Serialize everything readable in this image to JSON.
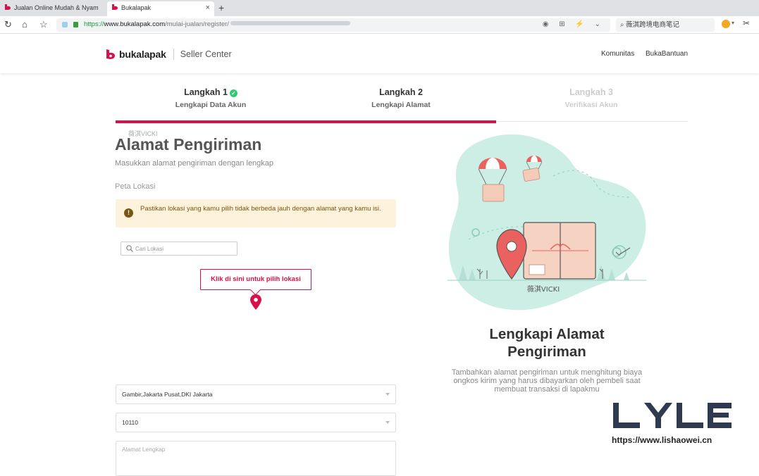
{
  "browser": {
    "tabs": [
      {
        "title": "Jualan Online Mudah & Nyam",
        "active": false
      },
      {
        "title": "Bukalapak",
        "active": true
      }
    ],
    "tab_close_glyph": "×",
    "new_tab_glyph": "+",
    "url": {
      "scheme": "https://",
      "host": "www.bukalapak.com",
      "path": "/mulai-jualan/register/"
    },
    "search_text": "薇淇跨境电商笔记"
  },
  "header": {
    "brand_name": "bukalapak",
    "brand_sub": "Seller Center",
    "links": [
      "Komunitas",
      "BukaBantuan"
    ],
    "brand_color": "#d71149"
  },
  "steps": [
    {
      "title": "Langkah 1",
      "subtitle": "Lengkapi Data Akun",
      "state": "done"
    },
    {
      "title": "Langkah 2",
      "subtitle": "Lengkapi Alamat",
      "state": "active"
    },
    {
      "title": "Langkah 3",
      "subtitle": "Verifikasi Akun",
      "state": "inactive"
    }
  ],
  "form": {
    "watermark": "薇淇VICKI",
    "title": "Alamat Pengiriman",
    "description": "Masukkan alamat pengiriman dengan lengkap",
    "map_section_label": "Peta Lokasi",
    "alert_text": "Pastikan lokasi yang kamu pilih tidak berbeda jauh dengan alamat yang kamu isi.",
    "map_search_placeholder": "Cari Lokasi",
    "map_tooltip": "Klik di sini untuk pilih lokasi",
    "area_value": "Gambir,Jakarta Pusat,DKI Jakarta",
    "postal_code_value": "10110",
    "full_address_placeholder": "Alamat Lengkap"
  },
  "illustration": {
    "watermark": "薇淇VICKI",
    "title_line1": "Lengkapi Alamat",
    "title_line2": "Pengiriman",
    "description": "Tambahkan alamat pengiriman untuk menghitung biaya ongkos kirim yang harus dibayarkan oleh pembeli saat membuat transaksi di lapakmu"
  },
  "overlay": {
    "logo_text": "LYLE",
    "url": "https://www.lishaowei.cn"
  }
}
